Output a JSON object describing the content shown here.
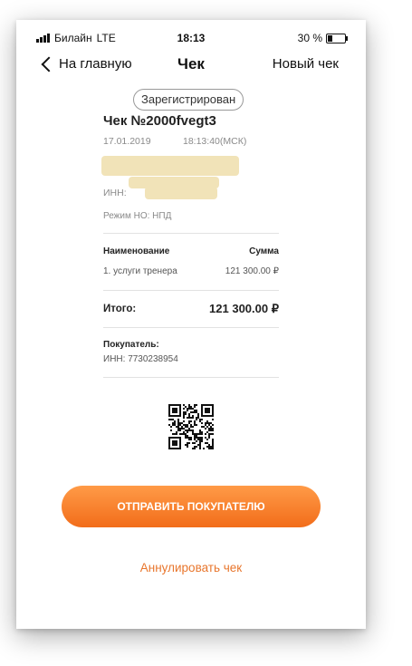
{
  "status_bar": {
    "carrier": "Билайн",
    "network": "LTE",
    "time": "18:13",
    "battery_percent": "30 %",
    "battery_level": 0.3
  },
  "nav": {
    "back_label": "На главную",
    "title": "Чек",
    "new_receipt_label": "Новый чек"
  },
  "receipt": {
    "status_badge": "Зарегистрирован",
    "title": "Чек №2000fvegt3",
    "date": "17.01.2019",
    "time": "18:13:40(МСК)",
    "inn_label": "ИНН:",
    "tax_mode": "Режим НО: НПД",
    "columns": {
      "name": "Наименование",
      "sum": "Сумма"
    },
    "items": [
      {
        "name": "1. услуги тренера",
        "sum": "121 300.00 ₽"
      }
    ],
    "total_label": "Итого:",
    "total_value": "121 300.00 ₽",
    "buyer_label": "Покупатель:",
    "buyer_inn": "ИНН: 7730238954"
  },
  "actions": {
    "send_label": "ОТПРАВИТЬ ПОКУПАТЕЛЮ",
    "cancel_label": "Аннулировать чек"
  },
  "colors": {
    "accent": "#f27a26",
    "redaction": "#f1e3b8"
  }
}
